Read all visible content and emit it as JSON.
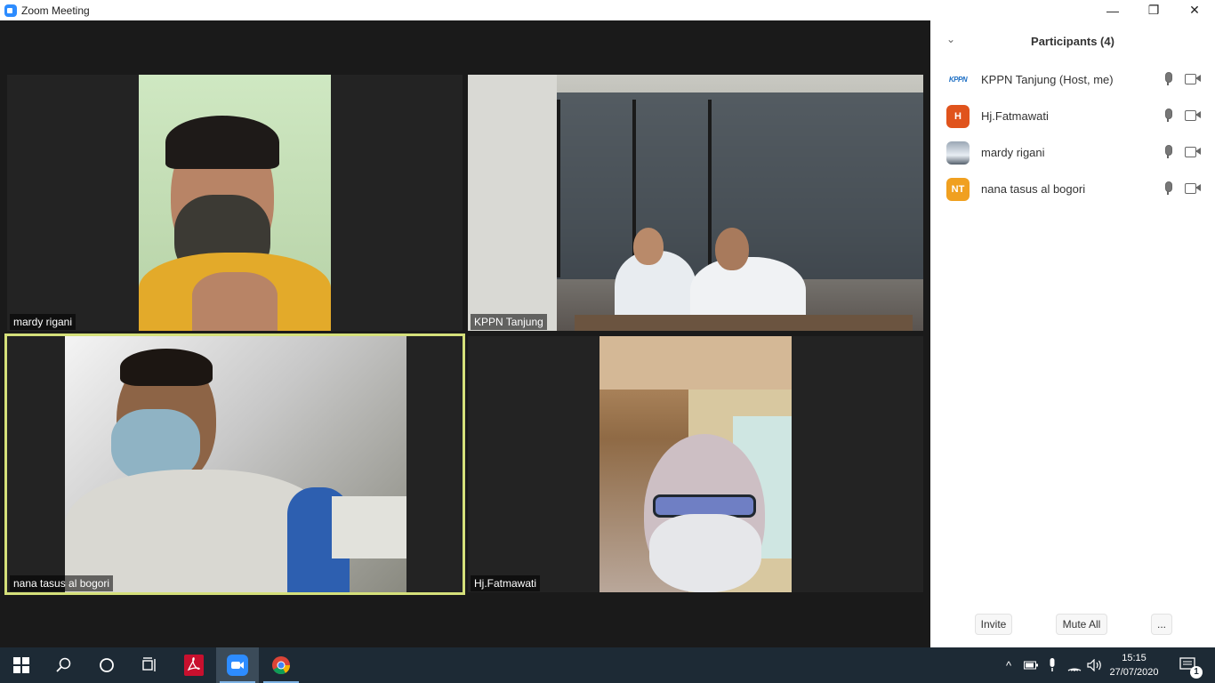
{
  "window": {
    "title": "Zoom Meeting",
    "minimize": "—",
    "restore": "❐",
    "close": "✕"
  },
  "tiles": [
    {
      "name": "mardy rigani"
    },
    {
      "name": "KPPN Tanjung"
    },
    {
      "name": "nana tasus al bogori"
    },
    {
      "name": "Hj.Fatmawati"
    }
  ],
  "participants_panel": {
    "title": "Participants (4)",
    "collapse_icon": "⌄",
    "participants": [
      {
        "name": "KPPN Tanjung (Host, me)",
        "avatar": "KPPN"
      },
      {
        "name": "Hj.Fatmawati",
        "avatar": "H"
      },
      {
        "name": "mardy rigani",
        "avatar": ""
      },
      {
        "name": "nana tasus al bogori",
        "avatar": "NT"
      }
    ],
    "invite_label": "Invite",
    "mute_all_label": "Mute All",
    "more_label": "..."
  },
  "taskbar": {
    "time": "15:15",
    "date": "27/07/2020",
    "notification_count": "1",
    "tray_chevron": "^"
  },
  "colors": {
    "active_speaker_border": "#d5e07a",
    "avatar_h": "#e0531c",
    "avatar_nt": "#f0a020",
    "taskbar_bg": "#1d2a35"
  }
}
